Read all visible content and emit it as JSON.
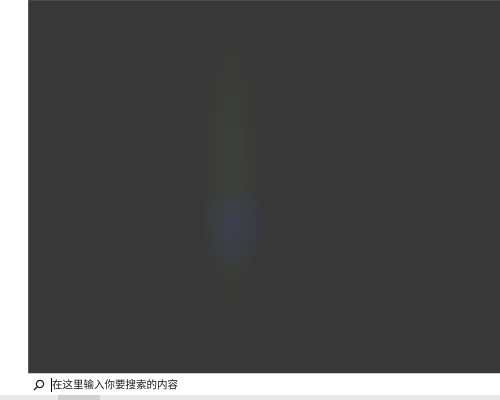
{
  "search": {
    "placeholder": "在这里输入你要搜索的内容",
    "icon": "search-icon"
  },
  "colors": {
    "flyout_background": "#383838",
    "search_bar_background": "#ffffff"
  }
}
